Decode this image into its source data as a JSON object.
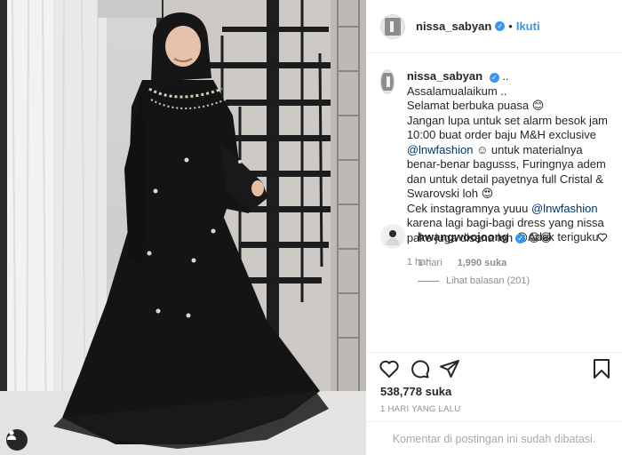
{
  "post": {
    "username": "nissa_sabyan",
    "verified": true,
    "separator": "•",
    "follow_label": "Ikuti",
    "caption_suffix": "..",
    "caption_lines": [
      "Assalamualaikum ..",
      "Selamat berbuka puasa 😊",
      "Jangan lupa untuk set alarm besok jam",
      "10:00 buat order baju M&H exclusive",
      "@lnwfashion ☺ untuk materialnya",
      "benar-benar bagusss, Furingnya adem",
      "dan untuk detail payetnya full Cristal &",
      "Swarovski loh 😍",
      "Cek instagramnya yuuu @lnwfashion",
      "karena lagi bagi-bagi dress yang nissa",
      "pake juga disana loh 😁😁😁"
    ],
    "caption_time": "1 hari",
    "likes": "538,778 suka",
    "timestamp": "1 HARI YANG LALU",
    "comments_disabled": "Komentar di postingan ini sudah dibatasi."
  },
  "comment": {
    "username": "hwangwoojoong",
    "verified": true,
    "text": "Adek teriguku",
    "time": "1 hari",
    "likes": "1,990 suka",
    "view_replies": "Lihat balasan (201)"
  },
  "icons": {
    "like": "heart-icon",
    "comment": "comment-icon",
    "share": "share-icon",
    "save": "bookmark-icon",
    "user_tag": "user-tag-icon"
  },
  "colors": {
    "link": "#3897f0",
    "mention": "#003569",
    "secondary": "#8e8e8e",
    "text": "#262626"
  }
}
